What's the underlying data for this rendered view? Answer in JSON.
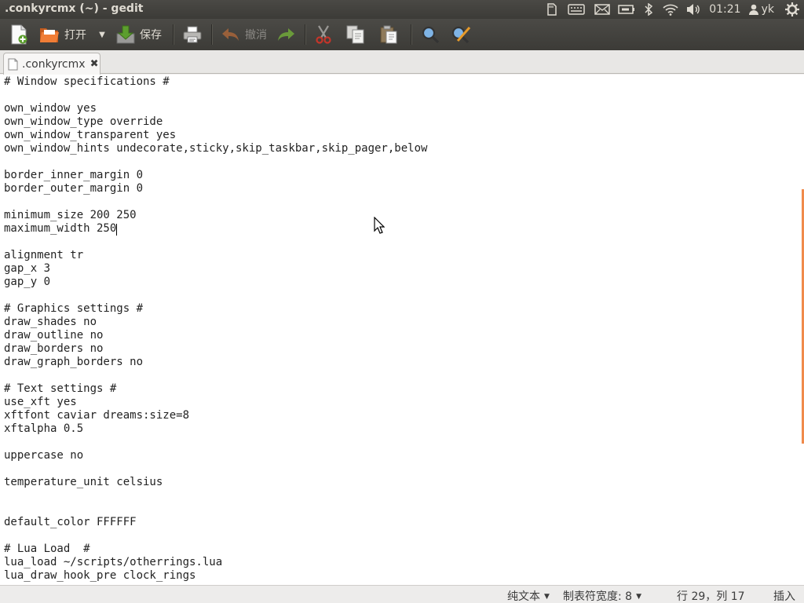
{
  "window": {
    "title": ".conkyrcmx (~) - gedit"
  },
  "panel": {
    "time": "01:21",
    "user": "yk",
    "icons": [
      "sd-card-icon",
      "keyboard-icon",
      "mail-icon",
      "battery-icon",
      "bluetooth-icon",
      "wifi-icon",
      "volume-icon",
      "user-icon",
      "gear-icon"
    ]
  },
  "toolbar": {
    "open_label": "打开",
    "save_label": "保存",
    "undo_label": "撤消"
  },
  "tabs": [
    {
      "label": ".conkyrcmx"
    }
  ],
  "document": {
    "lines": [
      "# Window specifications #",
      "",
      "own_window yes",
      "own_window_type override",
      "own_window_transparent yes",
      "own_window_hints undecorate,sticky,skip_taskbar,skip_pager,below",
      "",
      "border_inner_margin 0",
      "border_outer_margin 0",
      "",
      "minimum_size 200 250",
      "maximum_width 250",
      "",
      "alignment tr",
      "gap_x 3",
      "gap_y 0",
      "",
      "# Graphics settings #",
      "draw_shades no",
      "draw_outline no",
      "draw_borders no",
      "draw_graph_borders no",
      "",
      "# Text settings #",
      "use_xft yes",
      "xftfont caviar dreams:size=8",
      "xftalpha 0.5",
      "",
      "uppercase no",
      "",
      "temperature_unit celsius",
      "",
      "",
      "default_color FFFFFF",
      "",
      "# Lua Load  #",
      "lua_load ~/scripts/otherrings.lua",
      "lua_draw_hook_pre clock_rings"
    ]
  },
  "statusbar": {
    "language": "纯文本",
    "tab_width": "制表符宽度: 8",
    "position": "行 29，列 17",
    "mode": "插入"
  }
}
